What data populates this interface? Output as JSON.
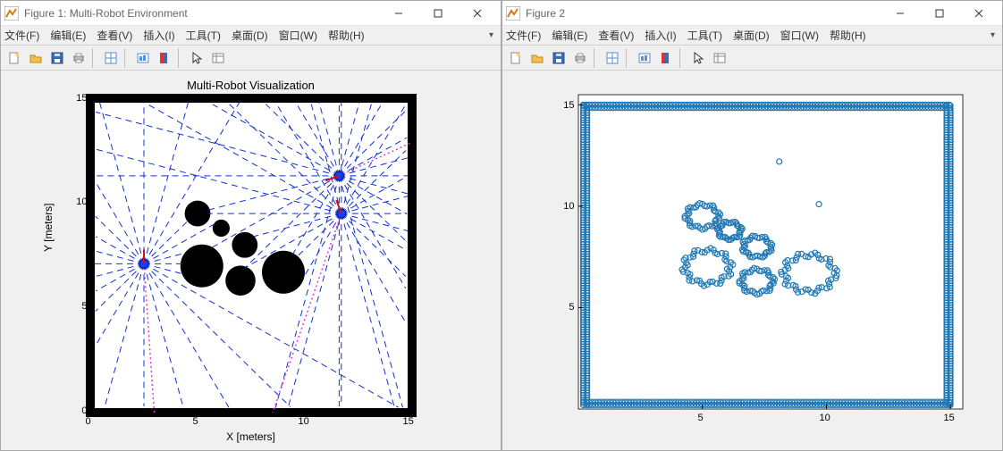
{
  "windows": [
    {
      "title": "Figure 1: Multi-Robot Environment",
      "menus": [
        "文件(F)",
        "编辑(E)",
        "查看(V)",
        "插入(I)",
        "工具(T)",
        "桌面(D)",
        "窗口(W)",
        "帮助(H)"
      ],
      "chart_title": "Multi-Robot Visualization",
      "xlabel": "X [meters]",
      "ylabel": "Y [meters]",
      "xticks": [
        "0",
        "5",
        "10",
        "15"
      ],
      "yticks": [
        "0",
        "5",
        "10",
        "15"
      ]
    },
    {
      "title": "Figure 2",
      "menus": [
        "文件(F)",
        "编辑(E)",
        "查看(V)",
        "插入(I)",
        "工具(T)",
        "桌面(D)",
        "窗口(W)",
        "帮助(H)"
      ],
      "chart_title": "",
      "xlabel": "",
      "ylabel": "",
      "xticks": [
        "5",
        "10",
        "15"
      ],
      "yticks": [
        "5",
        "10",
        "15"
      ]
    }
  ],
  "toolbar_icons": [
    "new-file-icon",
    "open-icon",
    "save-icon",
    "print-icon",
    "data-cursor-icon",
    "link-icon",
    "colorbar-icon",
    "pointer-icon",
    "inspect-icon"
  ],
  "chart_data": [
    {
      "type": "scatter",
      "title": "Multi-Robot Visualization",
      "xlabel": "X [meters]",
      "ylabel": "Y [meters]",
      "xlim": [
        0,
        15
      ],
      "ylim": [
        0,
        15
      ],
      "obstacles": [
        {
          "cx": 5.0,
          "cy": 9.5,
          "r": 0.6
        },
        {
          "cx": 6.1,
          "cy": 8.8,
          "r": 0.4
        },
        {
          "cx": 7.2,
          "cy": 8.0,
          "r": 0.6
        },
        {
          "cx": 5.2,
          "cy": 7.0,
          "r": 1.0
        },
        {
          "cx": 7.0,
          "cy": 6.3,
          "r": 0.7
        },
        {
          "cx": 9.0,
          "cy": 6.7,
          "r": 1.0
        }
      ],
      "robots": [
        {
          "x": 2.5,
          "y": 7.1,
          "heading_deg": 90,
          "paths": [
            [
              2.5,
              7.1
            ],
            [
              2.98,
              0
            ]
          ]
        },
        {
          "x": 11.6,
          "y": 11.3,
          "heading_deg": 200,
          "paths": [
            [
              11.6,
              11.3
            ],
            [
              15,
              12.9
            ]
          ]
        },
        {
          "x": 11.7,
          "y": 9.5,
          "heading_deg": 110,
          "paths": [
            [
              11.7,
              9.5
            ],
            [
              8.5,
              0
            ]
          ]
        }
      ],
      "lidar_rays_per_robot": 24,
      "wall_thickness": 0.3
    },
    {
      "type": "scatter",
      "title": "",
      "xlabel": "",
      "ylabel": "",
      "xlim": [
        0,
        15.5
      ],
      "ylim": [
        0,
        15.5
      ],
      "boundary_box": {
        "xmin": 0.2,
        "xmax": 15,
        "ymin": 0.2,
        "ymax": 15,
        "style": "dense-circles"
      },
      "clusters": [
        {
          "cx": 5.0,
          "cy": 9.5,
          "r": 0.7
        },
        {
          "cx": 6.1,
          "cy": 8.8,
          "r": 0.5
        },
        {
          "cx": 7.2,
          "cy": 8.0,
          "r": 0.6
        },
        {
          "cx": 5.2,
          "cy": 7.0,
          "r": 1.0
        },
        {
          "cx": 7.2,
          "cy": 6.3,
          "r": 0.7
        },
        {
          "cx": 9.3,
          "cy": 6.7,
          "r": 1.1
        }
      ],
      "outlier_points": [
        {
          "x": 8.1,
          "y": 12.2
        },
        {
          "x": 9.7,
          "y": 10.1
        }
      ]
    }
  ]
}
